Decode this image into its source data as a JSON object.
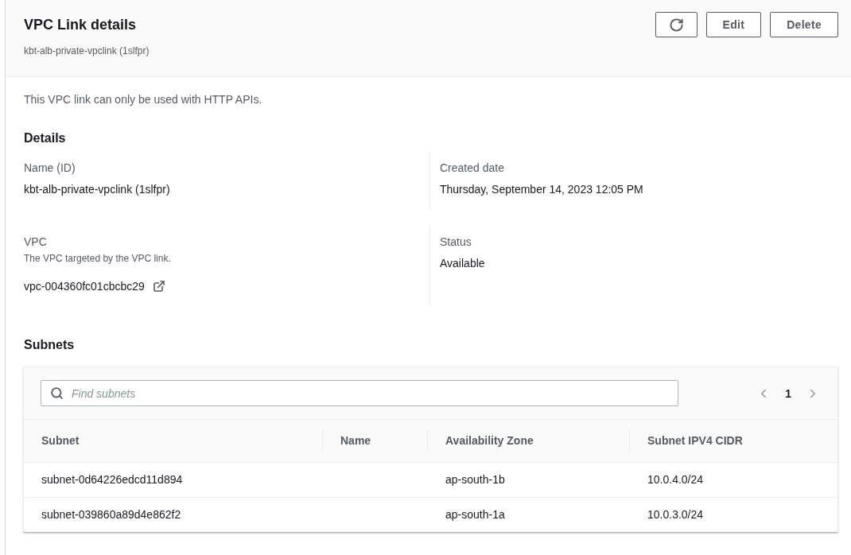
{
  "header": {
    "title": "VPC Link details",
    "subtitle": "kbt-alb-private-vpclink (1slfpr)",
    "actions": [
      {
        "kind": "refresh"
      },
      {
        "kind": "text",
        "label": "Edit"
      },
      {
        "kind": "text",
        "label": "Delete"
      }
    ]
  },
  "notice": "This VPC link can only be used with HTTP APIs.",
  "details": {
    "heading": "Details",
    "rows": [
      [
        {
          "label": "Name (ID)",
          "value": "kbt-alb-private-vpclink (1slfpr)",
          "external_link": false
        },
        {
          "label": "Created date",
          "value": "Thursday, September 14, 2023 12:05 PM",
          "external_link": false
        }
      ],
      [
        {
          "label": "VPC",
          "description": "The VPC targeted by the VPC link.",
          "value": "vpc-004360fc01cbcbc29",
          "external_link": true
        },
        {
          "label": "Status",
          "value": "Available",
          "external_link": false
        }
      ]
    ]
  },
  "subnets": {
    "heading": "Subnets",
    "search": {
      "placeholder": "Find subnets"
    },
    "pagination": {
      "pages": [
        {
          "label": "1",
          "selected": true
        }
      ]
    },
    "table": {
      "columns": [
        "Subnet",
        "Name",
        "Availability Zone",
        "Subnet IPV4 CIDR"
      ],
      "rows": [
        {
          "subnet": "subnet-0d64226edcd11d894",
          "availability_zone": "ap-south-1b",
          "subnet_ipv4_cidr": "10.0.4.0/24"
        },
        {
          "subnet": "subnet-039860a89d4e862f2",
          "availability_zone": "ap-south-1a",
          "subnet_ipv4_cidr": "10.0.3.0/24"
        }
      ]
    }
  }
}
